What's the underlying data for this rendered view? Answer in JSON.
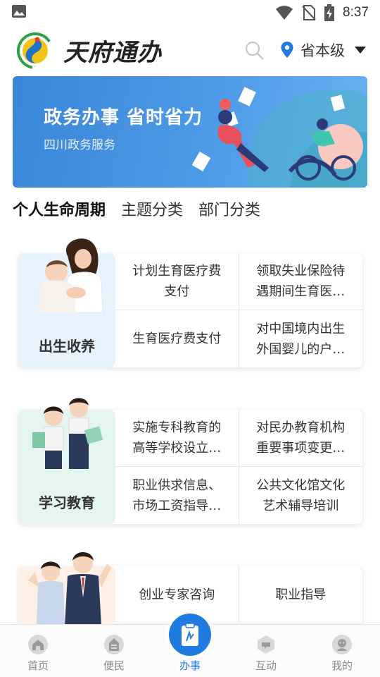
{
  "status_bar": {
    "time": "8:37",
    "icons": [
      "image-icon",
      "wifi-icon",
      "no-sim-icon",
      "battery-charging-icon"
    ]
  },
  "header": {
    "app_name": "天府通办",
    "search_icon": "search-icon",
    "region": "省本级",
    "location_icon": "location-pin-icon",
    "dropdown_icon": "caret-down-icon",
    "accent_color": "#1f7be0"
  },
  "banner": {
    "title": "政务办事 省时省力",
    "subtitle": "四川政务服务"
  },
  "tabs": [
    {
      "label": "个人生命周期",
      "active": true
    },
    {
      "label": "主题分类",
      "active": false
    },
    {
      "label": "部门分类",
      "active": false
    }
  ],
  "categories": [
    {
      "label": "出生收养",
      "items": [
        "计划生育医疗费支付",
        "领取失业保险待遇期间生育医疗费",
        "生育医疗费支付",
        "对中国境内出生外国婴儿的户籍办理"
      ]
    },
    {
      "label": "学习教育",
      "items": [
        "实施专科教育的高等学校设立审批",
        "对民办教育机构重要事项变更审批",
        "职业供求信息、市场工资指导价位",
        "公共文化馆文化艺术辅导培训"
      ]
    },
    {
      "label": "",
      "items": [
        "创业专家咨询",
        "职业指导"
      ]
    }
  ],
  "bottom_nav": [
    {
      "label": "首页",
      "icon": "home-icon",
      "active": false
    },
    {
      "label": "便民",
      "icon": "convenience-icon",
      "active": false
    },
    {
      "label": "办事",
      "icon": "clipboard-icon",
      "active": true
    },
    {
      "label": "互动",
      "icon": "interaction-icon",
      "active": false
    },
    {
      "label": "我的",
      "icon": "profile-icon",
      "active": false
    }
  ]
}
